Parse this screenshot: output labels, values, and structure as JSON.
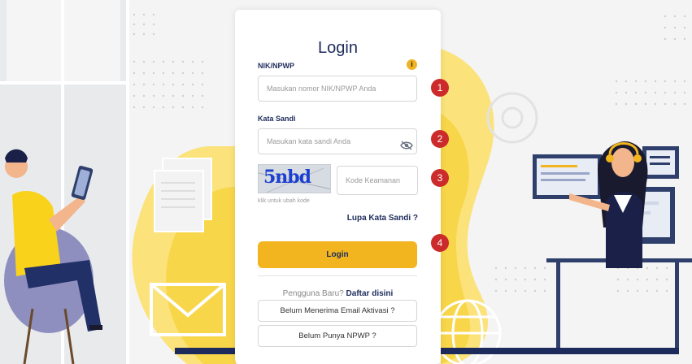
{
  "colors": {
    "accent": "#f2b51f",
    "brand": "#1d2b5c",
    "marker": "#cc2b2b",
    "captcha": "#1c3fcf"
  },
  "form": {
    "title": "Login",
    "nik_label": "NIK/NPWP",
    "nik_placeholder": "Masukan nomor NIK/NPWP Anda",
    "info_icon": "i",
    "password_label": "Kata Sandi",
    "password_placeholder": "Masukan kata sandi Anda",
    "captcha_text": "5nbd",
    "captcha_hint": "klik untuk ubah kode",
    "security_placeholder": "Kode Keamanan",
    "forgot_label": "Lupa Kata Sandi ?",
    "login_label": "Login",
    "register_prompt": "Pengguna Baru?",
    "register_link": "Daftar disini",
    "activation_label": "Belum Menerima Email Aktivasi ?",
    "npwp_label": "Belum Punya NPWP ?"
  },
  "markers": [
    "1",
    "2",
    "3",
    "4"
  ],
  "icons": {
    "info": "info-icon",
    "eye": "eye-slash-icon"
  }
}
